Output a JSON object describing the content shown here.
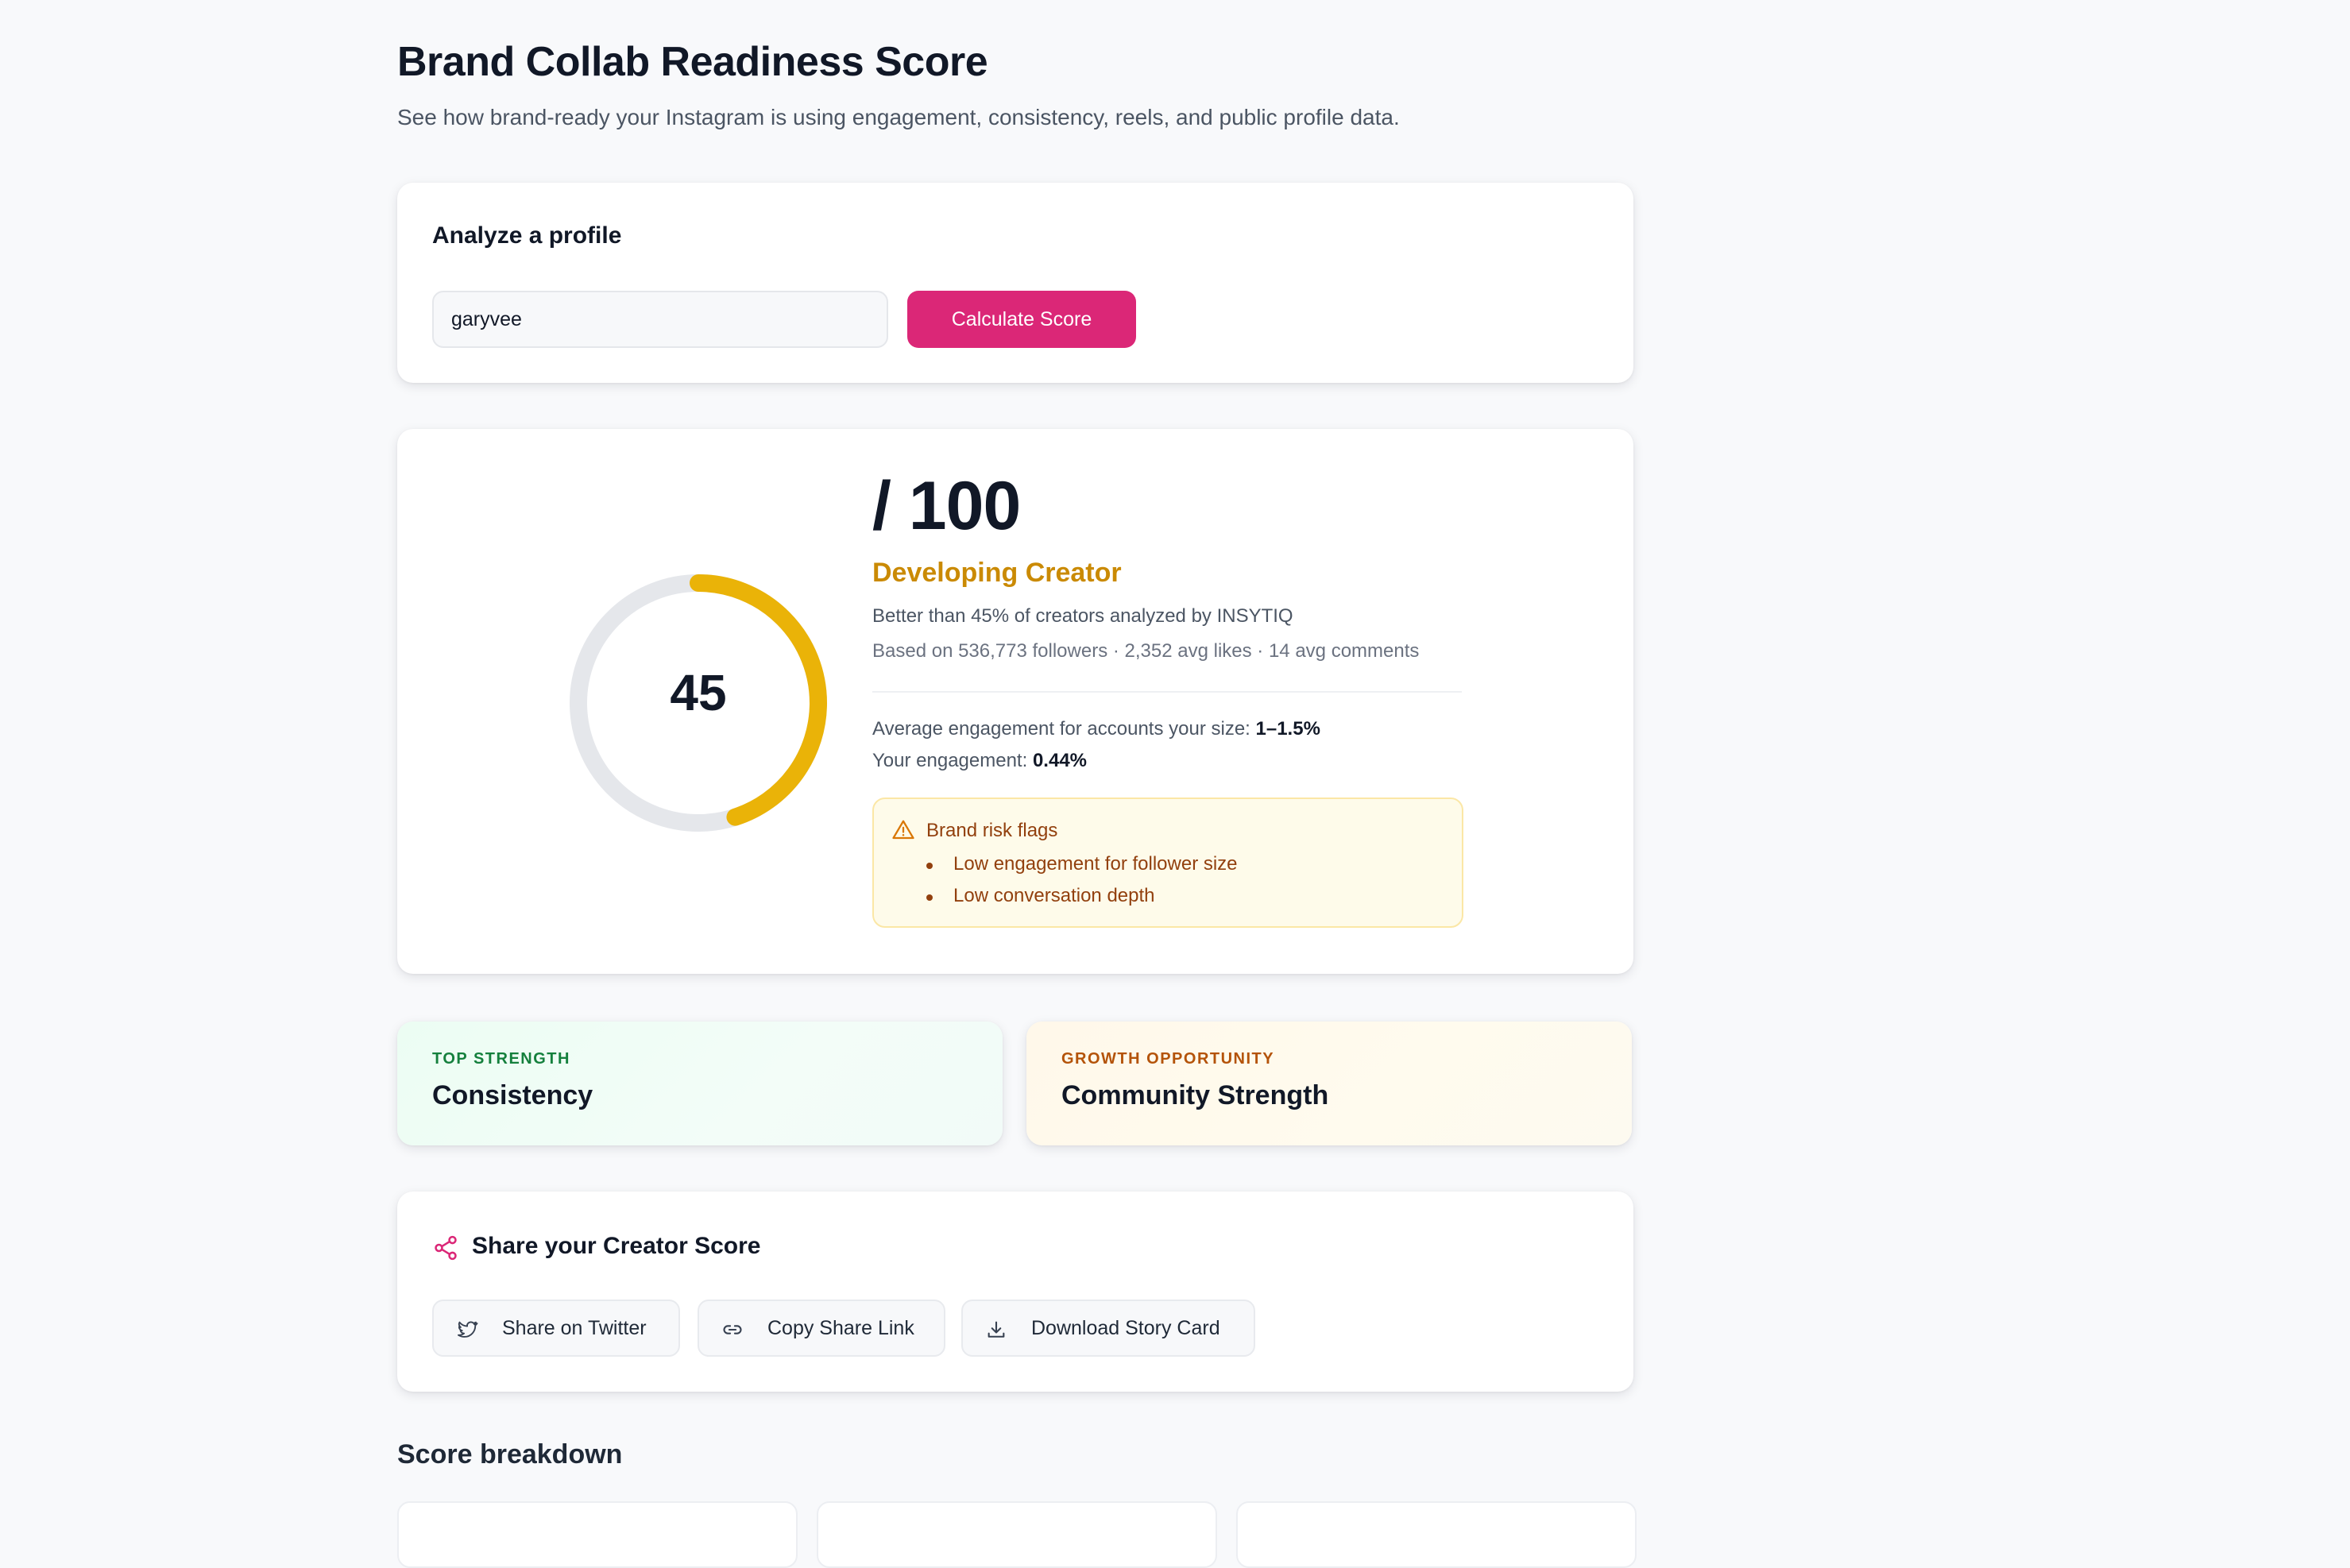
{
  "page": {
    "title": "Brand Collab Readiness Score",
    "subtitle": "See how brand-ready your Instagram is using engagement, consistency, reels, and public profile data."
  },
  "analyze": {
    "title": "Analyze a profile",
    "input_value": "garyvee",
    "button_label": "Calculate Score"
  },
  "score": {
    "value": "45",
    "fraction": 0.45,
    "out_of": "/ 100",
    "tier": "Developing Creator",
    "better_than": "Better than 45% of creators analyzed by INSYTIQ",
    "based_on": "Based on 536,773 followers · 2,352 avg likes · 14 avg comments",
    "avg_engagement_label": "Average engagement for accounts your size:",
    "avg_engagement_value": "1–1.5%",
    "your_engagement_label": "Your engagement:",
    "your_engagement_value": "0.44%",
    "colors": {
      "gauge": "#eab308",
      "track": "#e5e7eb",
      "tier": "#ca8a04"
    }
  },
  "risk_flags": {
    "title": "Brand risk flags",
    "icon": "warning-triangle-icon",
    "items": [
      "Low engagement for follower size",
      "Low conversation depth"
    ]
  },
  "top_strength": {
    "label": "TOP STRENGTH",
    "value": "Consistency",
    "color": "#15803d"
  },
  "growth_opportunity": {
    "label": "GROWTH OPPORTUNITY",
    "value": "Community Strength",
    "color": "#b45309"
  },
  "share": {
    "title": "Share your Creator Score",
    "icon": "share-icon",
    "buttons": [
      {
        "label": "Share on Twitter",
        "icon": "twitter-icon"
      },
      {
        "label": "Copy Share Link",
        "icon": "link-icon"
      },
      {
        "label": "Download Story Card",
        "icon": "download-icon"
      }
    ]
  },
  "breakdown": {
    "title": "Score breakdown"
  }
}
